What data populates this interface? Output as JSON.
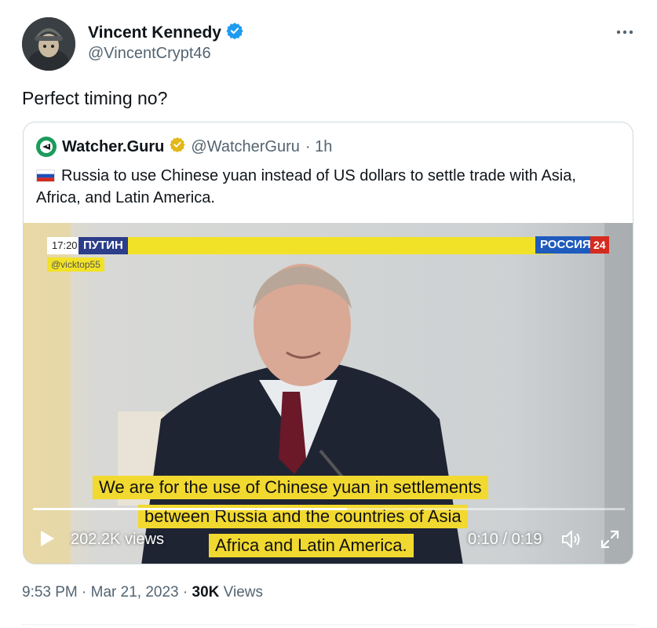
{
  "author": {
    "name": "Vincent Kennedy",
    "handle": "@VincentCrypt46",
    "verified_color": "#1d9bf0"
  },
  "tweet": {
    "text": "Perfect timing no?"
  },
  "quoted": {
    "name": "Watcher.Guru",
    "handle": "@WatcherGuru",
    "time": "· 1h",
    "verified_color": "#e2b719",
    "text": "Russia to use Chinese yuan instead of US dollars to settle trade with Asia, Africa, and Latin America.",
    "video": {
      "tv_time": "17:20",
      "tv_label": "ПУТИН",
      "channel": "РОССИЯ",
      "channel_num": "24",
      "watermark": "@vicktop55",
      "captions": [
        "We are for the use of Chinese yuan in settlements",
        "between Russia and the countries of Asia",
        "Africa and Latin America."
      ],
      "views": "202.2K views",
      "time_display": "0:10 / 0:19",
      "progress": 0.53
    }
  },
  "footer": {
    "time": "9:53 PM",
    "date": "Mar 21, 2023",
    "views_count": "30K",
    "views_label": "Views"
  }
}
